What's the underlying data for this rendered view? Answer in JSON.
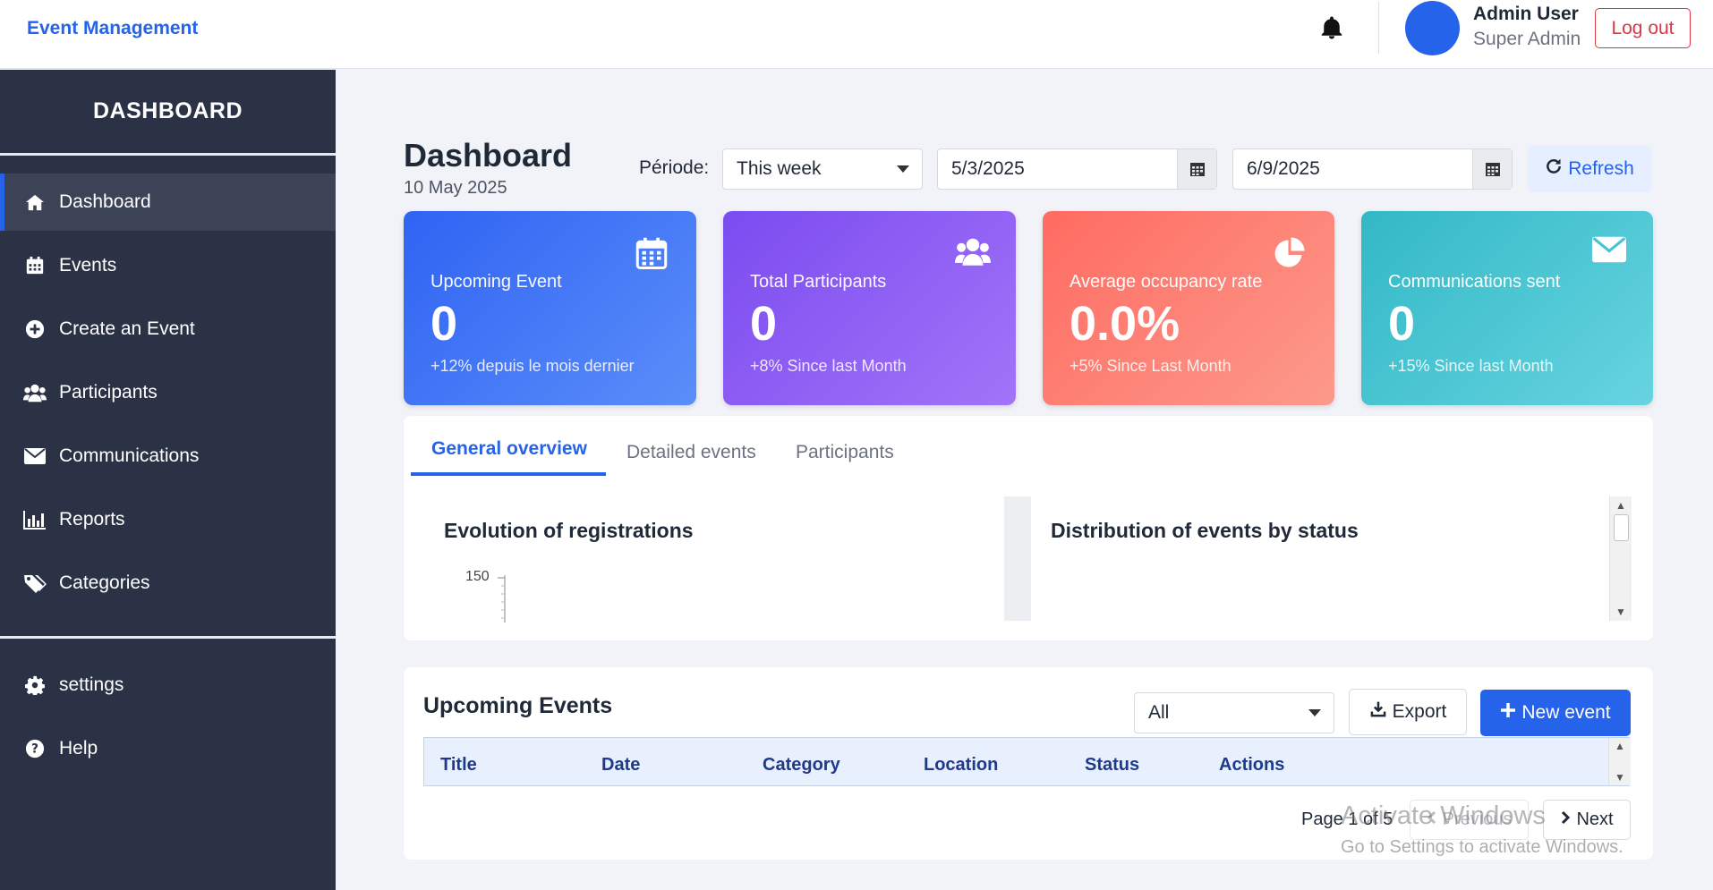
{
  "topbar": {
    "brand": "Event Management",
    "user_name": "Admin User",
    "user_role": "Super Admin",
    "logout_label": "Log out",
    "icons": [
      "bell-icon"
    ]
  },
  "sidebar": {
    "title": "DASHBOARD",
    "items": [
      {
        "label": "Dashboard",
        "icon": "home-icon",
        "active": true
      },
      {
        "label": "Events",
        "icon": "calendar-icon"
      },
      {
        "label": "Create an Event",
        "icon": "plus-circle-icon"
      },
      {
        "label": "Participants",
        "icon": "users-icon"
      },
      {
        "label": "Communications",
        "icon": "envelope-icon"
      },
      {
        "label": "Reports",
        "icon": "bar-chart-icon"
      },
      {
        "label": "Categories",
        "icon": "tags-icon"
      }
    ],
    "bottom_items": [
      {
        "label": "settings",
        "icon": "gear-icon"
      },
      {
        "label": "Help",
        "icon": "question-circle-icon"
      }
    ]
  },
  "header": {
    "title": "Dashboard",
    "date": "10 May 2025",
    "period_label": "Période:",
    "period_value": "This week",
    "date_from": "5/3/2025",
    "date_to": "6/9/2025",
    "refresh_label": "Refresh"
  },
  "cards": [
    {
      "label": "Upcoming Event",
      "value": "0",
      "sub": "+12% depuis le mois dernier",
      "icon": "calendar-icon",
      "color": "#3b6ef5"
    },
    {
      "label": "Total Participants",
      "value": "0",
      "sub": "+8% Since last Month",
      "icon": "users-icon",
      "color": "#8b5cf6"
    },
    {
      "label": "Average occupancy rate",
      "value": "0.0%",
      "sub": "+5% Since Last Month",
      "icon": "pie-chart-icon",
      "color": "#fb7b70"
    },
    {
      "label": "Communications sent",
      "value": "0",
      "sub": "+15% Since last Month",
      "icon": "envelope-icon",
      "color": "#45c4d2"
    }
  ],
  "overview": {
    "tabs": [
      {
        "label": "General overview",
        "active": true
      },
      {
        "label": "Detailed events"
      },
      {
        "label": "Participants"
      }
    ],
    "left_chart_title": "Evolution of registrations",
    "left_chart_tick": "150",
    "right_chart_title": "Distribution of events by status"
  },
  "events": {
    "title": "Upcoming Events",
    "filter_value": "All",
    "export_label": "Export",
    "new_label": "New event",
    "columns": [
      "Title",
      "Date",
      "Category",
      "Location",
      "Status",
      "Actions"
    ],
    "pager_text": "Page 1 of 5",
    "prev_label": "Previous",
    "next_label": "Next"
  },
  "watermark": {
    "line1": "Activate Windows",
    "line2": "Go to Settings to activate Windows."
  },
  "colors": {
    "accent": "#2563eb",
    "sidebar_bg": "#2b3245",
    "danger": "#dc3545"
  }
}
